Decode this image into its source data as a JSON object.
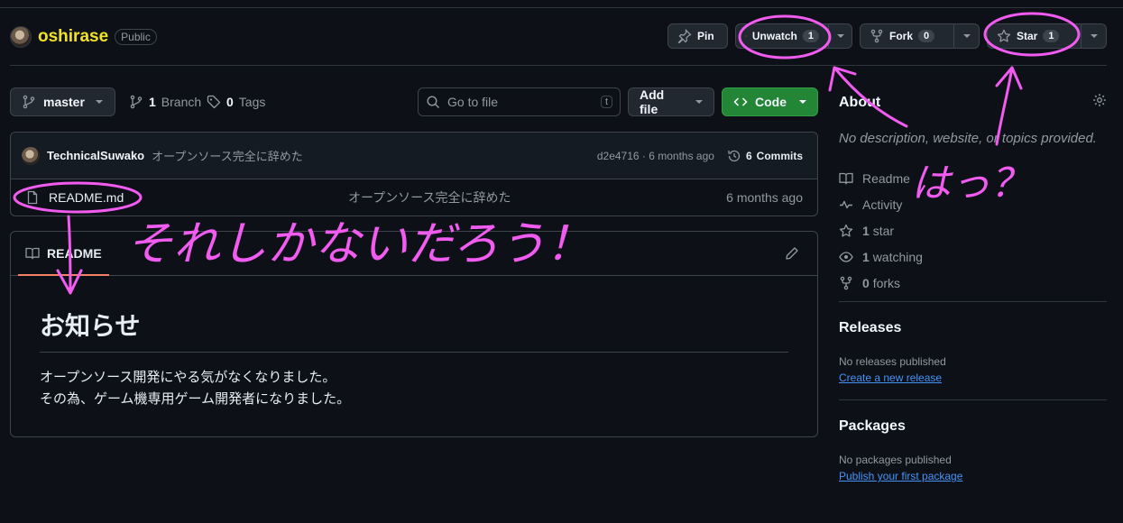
{
  "repo": {
    "name": "oshirase",
    "visibility": "Public"
  },
  "actions": {
    "pin_label": "Pin",
    "unwatch_label": "Unwatch",
    "unwatch_count": "1",
    "fork_label": "Fork",
    "fork_count": "0",
    "star_label": "Star",
    "star_count": "1"
  },
  "toolbar": {
    "branch": "master",
    "branch_count": "1",
    "branch_label": "Branch",
    "tag_count": "0",
    "tag_label": "Tags",
    "search_placeholder": "Go to file",
    "search_kbd": "t",
    "add_file_label": "Add file",
    "code_label": "Code"
  },
  "commit": {
    "author": "TechnicalSuwako",
    "message": "オープンソース完全に辞めた",
    "hash_time": "d2e4716 · 6 months ago",
    "commits_count": "6",
    "commits_label": "Commits"
  },
  "files": [
    {
      "name": "README.md",
      "message": "オープンソース完全に辞めた",
      "time": "6 months ago"
    }
  ],
  "readme": {
    "tab_label": "README",
    "heading": "お知らせ",
    "line1": "オープンソース開発にやる気がなくなりました。",
    "line2": "その為、ゲーム機専用ゲーム開発者になりました。"
  },
  "about": {
    "title": "About",
    "description": "No description, website, or topics provided.",
    "readme_link": "Readme",
    "activity_link": "Activity",
    "stars_count": "1",
    "stars_label": "star",
    "watching_count": "1",
    "watching_label": "watching",
    "forks_count": "0",
    "forks_label": "forks"
  },
  "releases": {
    "title": "Releases",
    "empty": "No releases published",
    "create_link": "Create a new release"
  },
  "packages": {
    "title": "Packages",
    "empty": "No packages published",
    "publish_link": "Publish your first package"
  },
  "annotations": {
    "color": "#f15bf0",
    "main_text": "それしかないだろう！",
    "side_text": "はっ？"
  },
  "colors": {
    "background": "#0d1117",
    "repo_name": "#f2e227",
    "code_button": "#238636",
    "link": "#4493f8"
  }
}
